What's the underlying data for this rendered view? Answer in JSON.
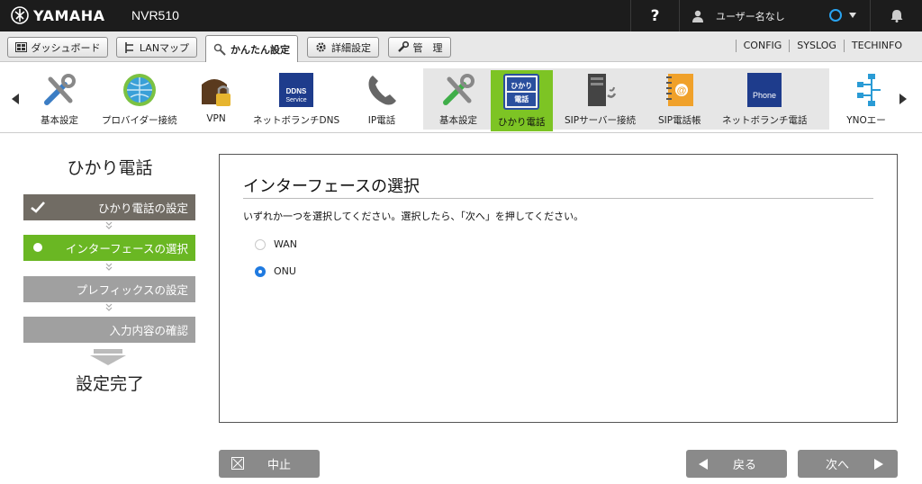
{
  "header": {
    "brand": "YAMAHA",
    "model": "NVR510",
    "help_glyph": "?",
    "user_name": "ユーザー名なし"
  },
  "tabs": [
    {
      "label": "ダッシュボード",
      "icon": "dashboard-icon"
    },
    {
      "label": "LANマップ",
      "icon": "lan-map-icon"
    },
    {
      "label": "かんたん設定",
      "icon": "wizard-icon",
      "active": true
    },
    {
      "label": "詳細設定",
      "icon": "gear-icon"
    },
    {
      "label": "管　理",
      "icon": "wrench-icon"
    }
  ],
  "top_links": [
    "CONFIG",
    "SYSLOG",
    "TECHINFO"
  ],
  "icon_strip": [
    {
      "label": "基本設定",
      "icon": "tools-icon"
    },
    {
      "label": "プロバイダー接続",
      "icon": "globe-icon"
    },
    {
      "label": "VPN",
      "icon": "vpn-lock-icon"
    },
    {
      "label": "ネットボランチDNS",
      "icon": "ddns-icon",
      "badge": "DDNS Service"
    },
    {
      "label": "IP電話",
      "icon": "phone-icon"
    },
    {
      "label": "基本設定",
      "icon": "tools-icon"
    },
    {
      "label": "ひかり電話",
      "icon": "hikari-denwa-icon",
      "selected": true,
      "badge_top": "ひかり",
      "badge_bottom": "電話"
    },
    {
      "label": "SIPサーバー接続",
      "icon": "sip-server-icon"
    },
    {
      "label": "SIP電話帳",
      "icon": "address-book-icon"
    },
    {
      "label": "ネットボランチ電話",
      "icon": "netvolante-phone-icon",
      "badge": "Phone"
    },
    {
      "label": "YNOエー",
      "icon": "yno-network-icon"
    }
  ],
  "wizard": {
    "title": "ひかり電話",
    "steps": [
      {
        "label": "ひかり電話の設定",
        "state": "done"
      },
      {
        "label": "インターフェースの選択",
        "state": "current"
      },
      {
        "label": "プレフィックスの設定",
        "state": "pending"
      },
      {
        "label": "入力内容の確認",
        "state": "pending"
      }
    ],
    "complete_label": "設定完了"
  },
  "panel": {
    "title": "インターフェースの選択",
    "description": "いずれか一つを選択してください。選択したら、「次へ」を押してください。",
    "options": [
      {
        "label": "WAN",
        "checked": false
      },
      {
        "label": "ONU",
        "checked": true
      }
    ]
  },
  "buttons": {
    "cancel": "中止",
    "back": "戻る",
    "next": "次へ"
  },
  "colors": {
    "topbar": "#1c1c1c",
    "step_done": "#716c64",
    "step_current": "#6ab723",
    "step_pending": "#a0a0a0",
    "selected_icon_bg": "#7dc424",
    "radio_checked": "#1f7ae0",
    "button": "#8a8a8a"
  }
}
